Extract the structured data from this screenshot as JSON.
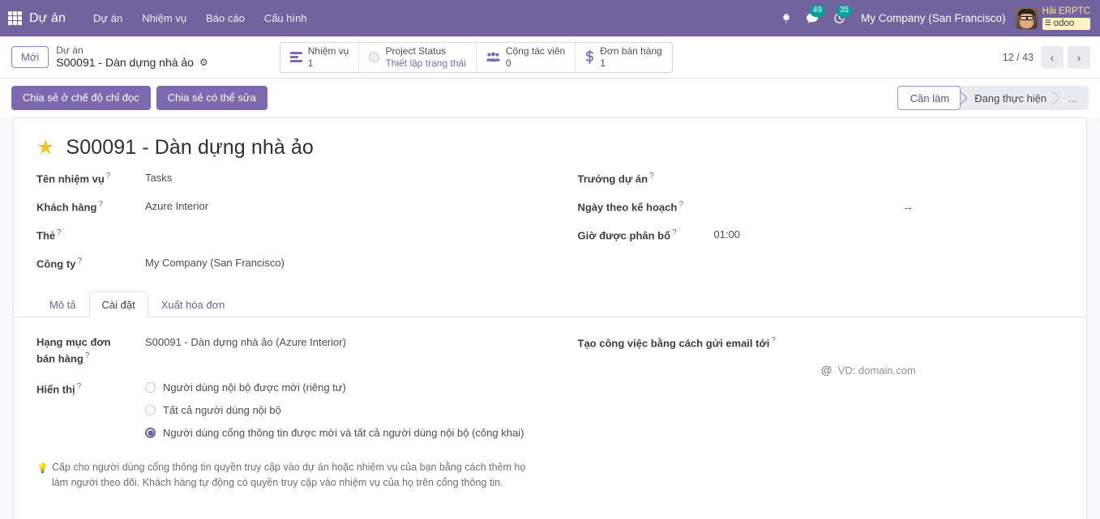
{
  "navbar": {
    "apps_icon": "apps-grid-icon",
    "brand": "Dự án",
    "menu": [
      {
        "label": "Dự án"
      },
      {
        "label": "Nhiệm vụ"
      },
      {
        "label": "Báo cáo"
      },
      {
        "label": "Cấu hình"
      }
    ],
    "icons": {
      "bug": "bug-icon",
      "messages": "chat-icon",
      "activities": "clock-icon"
    },
    "messages_count": "49",
    "activities_count": "35",
    "company": "My Company (San Francisco)",
    "user_name": "Hải ERPTC",
    "database": "odoo",
    "accent": "#71639E"
  },
  "control_panel": {
    "state_badge": "Mới",
    "breadcrumb_parent": "Dự án",
    "breadcrumb_current": "S00091 - Dàn dựng nhà ảo",
    "gear_icon": "gear-icon",
    "stat_buttons": [
      {
        "icon": "tasks-bars-icon",
        "label": "Nhiệm vụ",
        "value": "1",
        "is_link": false
      },
      {
        "icon": "circle-icon",
        "label": "Project Status",
        "value": "Thiết lập trạng thái",
        "is_link": true
      },
      {
        "icon": "users-icon",
        "label": "Cộng tác viên",
        "value": "0",
        "is_link": false
      },
      {
        "icon": "dollar-icon",
        "label": "Đơn bán hàng",
        "value": "1",
        "is_link": false
      }
    ],
    "pager": {
      "count": "12 / 43",
      "prev_icon": "chevron-left-icon",
      "next_icon": "chevron-right-icon"
    }
  },
  "actions": {
    "share_readonly": "Chia sẻ ở chế độ chỉ đọc",
    "share_editable": "Chia sẻ có thể sửa"
  },
  "statusbar": {
    "steps": [
      {
        "label": "Cần làm",
        "active": true
      },
      {
        "label": "Đang thực hiện",
        "active": false
      },
      {
        "label": "...",
        "active": false
      }
    ]
  },
  "form": {
    "star_icon": "star-icon",
    "title": "S00091 - Dàn dựng nhà ảo",
    "left_fields": [
      {
        "label": "Tên nhiệm vụ",
        "value": "Tasks"
      },
      {
        "label": "Khách hàng",
        "value": "Azure Interior"
      },
      {
        "label": "Thẻ",
        "value": ""
      },
      {
        "label": "Công ty",
        "value": "My Company (San Francisco)"
      }
    ],
    "right_fields": [
      {
        "label": "Trưởng dự án",
        "value": ""
      },
      {
        "label": "Ngày theo kế hoạch",
        "value": ""
      },
      {
        "label": "Giờ được phân bổ",
        "value": "01:00"
      }
    ],
    "date_arrow": "→"
  },
  "notebook": {
    "tabs": [
      {
        "label": "Mô tả",
        "active": false
      },
      {
        "label": "Cài đặt",
        "active": true
      },
      {
        "label": "Xuất hóa đơn",
        "active": false
      }
    ],
    "settings": {
      "sale_line_label": "Hạng mục đơn bán hàng",
      "sale_line_value": "S00091 - Dàn dựng nhà ảo (Azure Interior)",
      "visibility_label": "Hiển thị",
      "visibility_options": [
        {
          "label": "Người dùng nội bộ được mời (riêng tư)",
          "checked": false
        },
        {
          "label": "Tất cả người dùng nội bộ",
          "checked": false
        },
        {
          "label": "Người dùng cổng thông tin được mời và tất cả người dùng nội bộ (công khai)",
          "checked": true
        }
      ],
      "help_text": "Cấp cho người dùng cổng thông tin quyền truy cập vào dự án hoặc nhiệm vụ của bạn bằng cách thêm họ làm người theo dõi. Khách hàng tự động có quyền truy cập vào nhiệm vụ của họ trên cổng thông tin.",
      "help_icon": "lightbulb-icon",
      "email_alias_label": "Tạo công việc bằng cách gửi email tới",
      "email_alias_placeholder": "VD: domain.com",
      "at_icon": "at-icon"
    }
  }
}
